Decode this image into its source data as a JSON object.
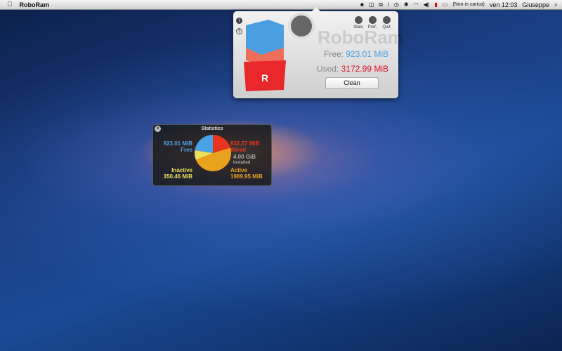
{
  "menubar": {
    "app": "RoboRam",
    "battery": "(Non in carica)",
    "clock": "ven 12:03",
    "user": "Giuseppe"
  },
  "panel": {
    "logo": "RoboRam",
    "tools": [
      "Stats",
      "Pref.",
      "Quit"
    ],
    "free_label": "Free:",
    "free_value": "923.01 MiB",
    "used_label": "Used:",
    "used_value": "3172.99 MiB",
    "clean": "Clean",
    "info": "i",
    "help": "?"
  },
  "stats": {
    "title": "Statistics",
    "free_value": "923.01 MiB",
    "free_label": "Free",
    "wired_value": "832.57 MiB",
    "wired_label": "Wired",
    "installed_value": "4.00 GiB",
    "installed_label": "Installed",
    "inactive_label": "Inactive",
    "inactive_value": "350.46 MiB",
    "active_label": "Active",
    "active_value": "1989.95 MiB"
  },
  "chart_data": {
    "type": "pie",
    "unit": "MiB",
    "slices": [
      {
        "name": "Wired",
        "value": 832.57,
        "color": "#e8341f"
      },
      {
        "name": "Active",
        "value": 1989.95,
        "color": "#e8a21e"
      },
      {
        "name": "Inactive",
        "value": 350.46,
        "color": "#ece25a"
      },
      {
        "name": "Free",
        "value": 923.01,
        "color": "#4aa3e8"
      }
    ]
  }
}
